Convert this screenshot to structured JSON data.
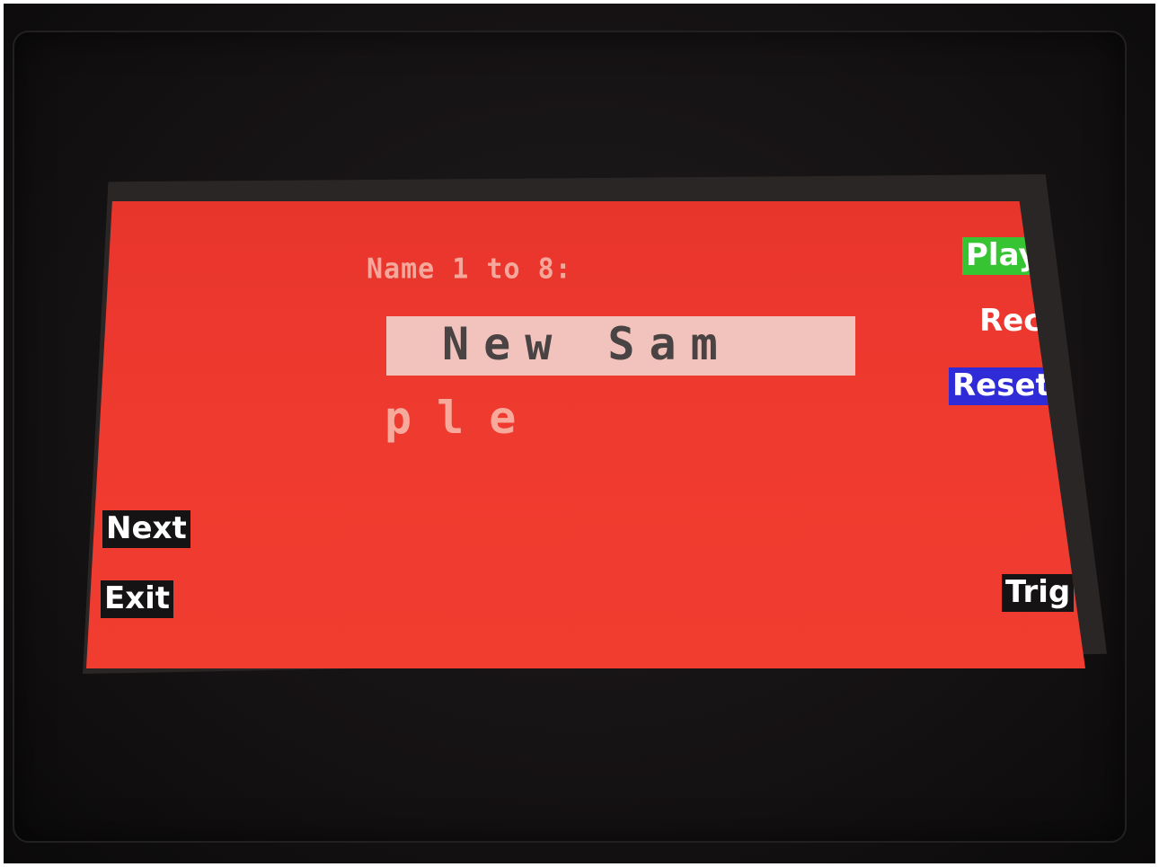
{
  "screen": {
    "prompt": "Name 1 to 8:",
    "name_line1": "New Sam",
    "name_line2": "ple"
  },
  "softkeys": {
    "play": "Play",
    "rec": "Rec",
    "reset": "Reset",
    "next": "Next",
    "exit": "Exit",
    "trig": "Trig"
  },
  "colors": {
    "screen_bg": "#ef3a2f",
    "play_bg": "#36c433",
    "reset_bg": "#2f2bd6",
    "softkey_bg": "#151314",
    "name_box_bg": "#f2c3bc"
  }
}
